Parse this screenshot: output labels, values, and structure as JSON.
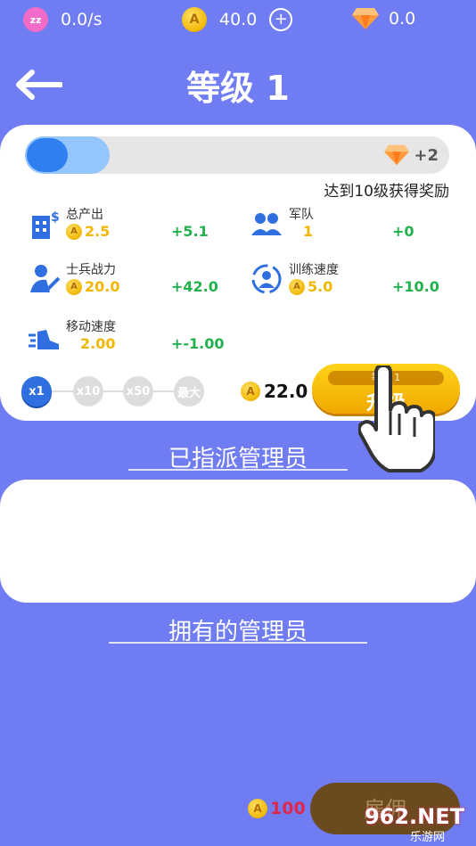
{
  "topbar": {
    "idle_rate": "0.0/s",
    "coins": "40.0",
    "gems": "0.0",
    "icons": [
      "sleep-icon",
      "coin-icon",
      "add-icon",
      "gem-icon"
    ]
  },
  "header": {
    "title": "等级 1"
  },
  "level_card": {
    "progress_fraction": 0.2,
    "reward_label": "+2",
    "goal_text": "达到10级获得奖励",
    "stats": [
      {
        "name": "总产出",
        "value": "2.5",
        "increase": "+5.1"
      },
      {
        "name": "军队",
        "value": "1",
        "increase": "+0"
      },
      {
        "name": "士兵战力",
        "value": "20.0",
        "increase": "+42.0"
      },
      {
        "name": "训练速度",
        "value": "5.0",
        "increase": "+10.0"
      },
      {
        "name": "移动速度",
        "value": "2.00",
        "increase": "+-1.00"
      }
    ],
    "multipliers": [
      "x1",
      "x10",
      "x50",
      "最大"
    ],
    "selected_multiplier": "x1",
    "upgrade_cost": "22.0",
    "upgrade_bar_text": "等级 1",
    "upgrade_label": "升级"
  },
  "assigned_section": {
    "title": "已指派管理员"
  },
  "owned_section": {
    "title": "拥有的管理员"
  },
  "hire": {
    "cost": "100",
    "label": "雇佣"
  },
  "watermark": {
    "text": "962.NET",
    "subtext": "乐游网"
  },
  "colors": {
    "background": "#6f7cf2",
    "accent_blue": "#2f7ff0",
    "gold": "#f2b705",
    "green": "#22b14c",
    "red": "#e0264a"
  }
}
